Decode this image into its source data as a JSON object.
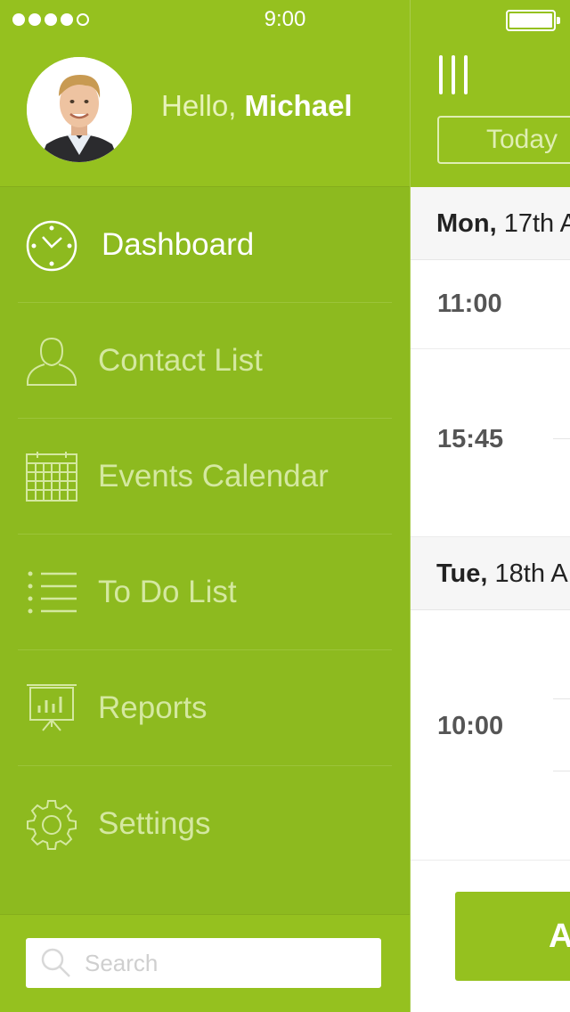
{
  "status_bar": {
    "time": "9:00",
    "signal_bars": 4,
    "signal_total": 5,
    "battery_level": 1.0
  },
  "profile": {
    "greeting": "Hello,",
    "name": "Michael"
  },
  "menu": {
    "items": [
      {
        "label": "Dashboard",
        "icon": "clock-icon",
        "active": true
      },
      {
        "label": "Contact List",
        "icon": "person-icon",
        "active": false
      },
      {
        "label": "Events Calendar",
        "icon": "calendar-icon",
        "active": false
      },
      {
        "label": "To Do List",
        "icon": "list-icon",
        "active": false
      },
      {
        "label": "Reports",
        "icon": "presentation-chart-icon",
        "active": false
      },
      {
        "label": "Settings",
        "icon": "gear-icon",
        "active": false
      }
    ]
  },
  "search": {
    "placeholder": "Search",
    "value": ""
  },
  "main": {
    "today_label": "Today",
    "days": [
      {
        "weekday": "Mon,",
        "date": "17th A"
      },
      {
        "weekday": "Tue,",
        "date": "18th A"
      }
    ],
    "times": [
      "11:00",
      "15:45",
      "10:00"
    ],
    "add_button_label": "A"
  },
  "colors": {
    "accent": "#95c11f",
    "drawer_bg": "#8dba1f",
    "menu_text": "#d4e8a0",
    "active_text": "#ffffff"
  }
}
